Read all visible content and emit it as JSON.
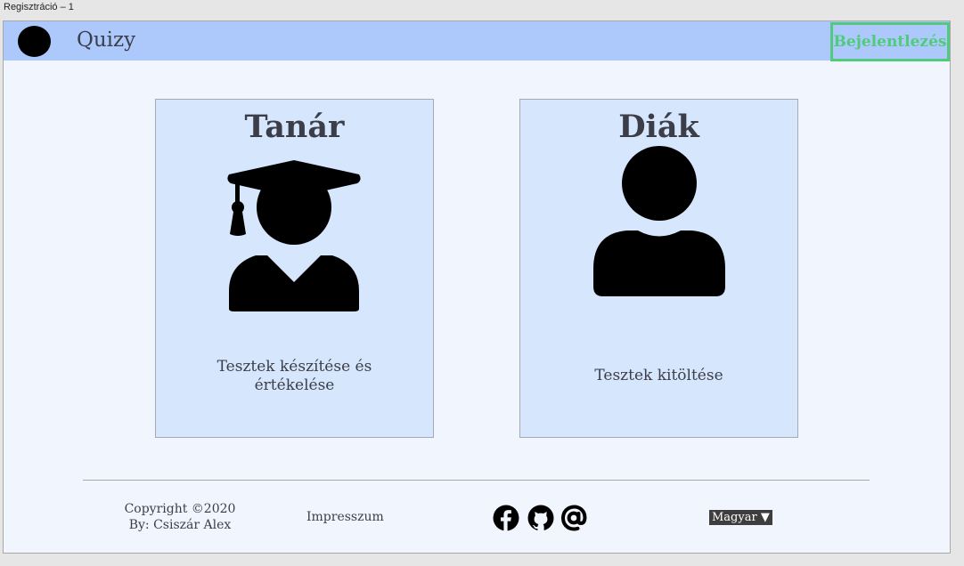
{
  "window": {
    "title": "Regisztráció – 1"
  },
  "header": {
    "brand": "Quizy",
    "login_label": "Bejelentlezés"
  },
  "cards": [
    {
      "title": "Tanár",
      "icon": "graduate-user-icon",
      "description": "Tesztek készítése és értékelése"
    },
    {
      "title": "Diák",
      "icon": "user-icon",
      "description": "Tesztek kitöltése"
    }
  ],
  "footer": {
    "copyright_line1": "Copyright ©2020",
    "copyright_line2": "By: Csiszár Alex",
    "impressum": "Impresszum",
    "social_icons": [
      "facebook-icon",
      "github-icon",
      "at-sign-icon"
    ],
    "language": "Magyar ▼"
  },
  "colors": {
    "header_bg": "#adc9fc",
    "page_bg": "#f1f6fe",
    "card_bg": "#d6e6fd",
    "accent_green": "#4fcb7b"
  }
}
